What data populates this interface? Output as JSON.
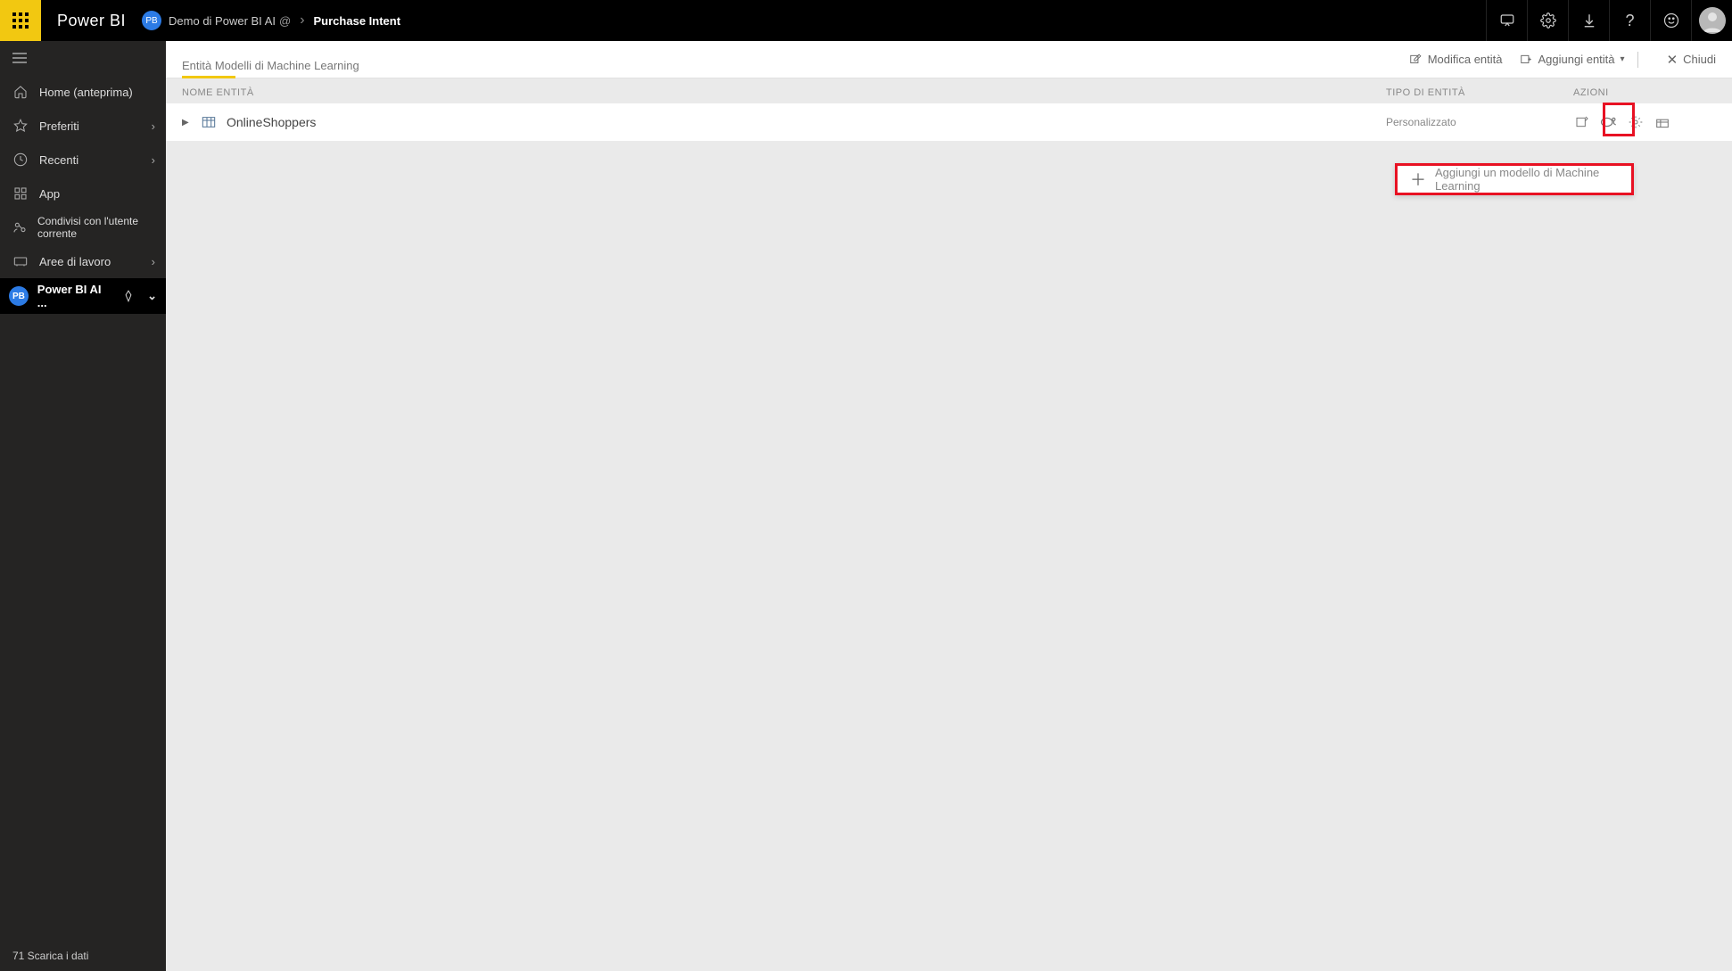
{
  "brand": "Power BI",
  "breadcrumb": {
    "badge": "PB",
    "workspace": "Demo di Power BI AI",
    "workspace_suffix": "@",
    "title": "Purchase Intent"
  },
  "leftnav": {
    "items": [
      {
        "icon": "home",
        "label": "Home (anteprima)",
        "chevron": false
      },
      {
        "icon": "star",
        "label": "Preferiti",
        "chevron": true
      },
      {
        "icon": "clock",
        "label": "Recenti",
        "chevron": true
      },
      {
        "icon": "apps",
        "label": "App",
        "chevron": false
      },
      {
        "icon": "share",
        "label": "Condivisi con l'utente corrente",
        "chevron": false
      },
      {
        "icon": "workspace",
        "label": "Aree di lavoro",
        "chevron": true
      }
    ],
    "workspace": {
      "badge": "PB",
      "label": "Power BI AI ..."
    },
    "footer": "71 Scarica i dati"
  },
  "toolbar": {
    "tab_ml": "Entità Modelli di Machine Learning",
    "edit": "Modifica entità",
    "add": "Aggiungi entità",
    "close": "Chiudi"
  },
  "columns": {
    "name": "NOME ENTITÀ",
    "type": "TIPO DI ENTITÀ",
    "actions": "AZIONI"
  },
  "entity": {
    "name": "OnlineShoppers",
    "type": "Personalizzato"
  },
  "dropdown": {
    "add_ml": "Aggiungi un modello di Machine Learning"
  }
}
